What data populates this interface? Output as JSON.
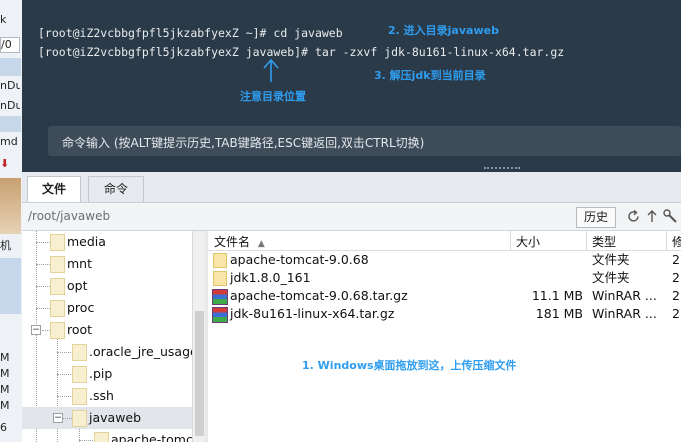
{
  "left_strip": {
    "cells": [
      "k",
      "/0",
      "nDu",
      "nDu",
      "md",
      "⬇",
      "机",
      "M",
      "M",
      "M",
      "M",
      "6"
    ]
  },
  "terminal": {
    "lines": [
      "[root@iZ2vcbbgfpfl5jkzabfyexZ ~]# cd javaweb",
      "[root@iZ2vcbbgfpfl5jkzabfyexZ javaweb]# tar -zxvf jdk-8u161-linux-x64.tar.gz"
    ],
    "annotations": {
      "enter_dir": "2.  进入目录javaweb",
      "extract": "3.  解压jdk到当前目录",
      "note_location": "注意目录位置"
    },
    "command_input_hint": "命令输入 (按ALT键提示历史,TAB键路径,ESC键返回,双击CTRL切换)",
    "accent_color": "#2e9df0"
  },
  "tabs": [
    {
      "label": "文件",
      "active": true
    },
    {
      "label": "命令",
      "active": false
    }
  ],
  "path_bar": {
    "path": "/root/javaweb",
    "history_label": "历史"
  },
  "tree": {
    "items": [
      {
        "label": "media"
      },
      {
        "label": "mnt"
      },
      {
        "label": "opt"
      },
      {
        "label": "proc"
      },
      {
        "label": "root"
      },
      {
        "label": ".oracle_jre_usage"
      },
      {
        "label": ".pip"
      },
      {
        "label": ".ssh"
      },
      {
        "label": "javaweb"
      },
      {
        "label": "apache-tomcat"
      }
    ]
  },
  "file_list": {
    "columns": {
      "name": "文件名",
      "size": "大小",
      "type": "类型",
      "modified": "修"
    },
    "rows": [
      {
        "name": "apache-tomcat-9.0.68",
        "size": "",
        "type": "文件夹",
        "modified": "2",
        "icon": "folder-icon"
      },
      {
        "name": "jdk1.8.0_161",
        "size": "",
        "type": "文件夹",
        "modified": "2",
        "icon": "folder-icon"
      },
      {
        "name": "apache-tomcat-9.0.68.tar.gz",
        "size": "11.1 MB",
        "type": "WinRAR ...",
        "modified": "2",
        "icon": "winrar-archive-icon"
      },
      {
        "name": "jdk-8u161-linux-x64.tar.gz",
        "size": "181 MB",
        "type": "WinRAR ...",
        "modified": "2",
        "icon": "winrar-archive-icon"
      }
    ],
    "annotation": "1.  Windows桌面拖放到这，上传压缩文件"
  }
}
